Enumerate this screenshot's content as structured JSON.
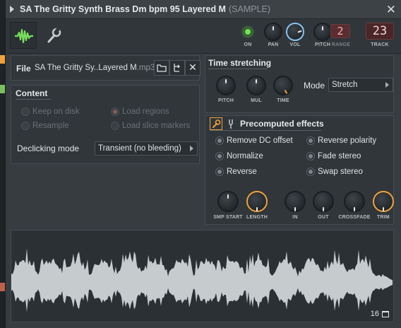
{
  "window": {
    "title": "SA The Gritty Synth Brass Dm bpm 95 Layered M",
    "title_suffix": "(SAMPLE)",
    "close_glyph": "✕"
  },
  "toolbar": {
    "tabs": [
      {
        "name": "waveform-tab",
        "icon": "waveform-icon",
        "active": true
      },
      {
        "name": "settings-tab",
        "icon": "wrench-icon",
        "active": false
      }
    ],
    "on_label": "ON",
    "pan_label": "PAN",
    "vol_label": "VOL",
    "pitch_label": "PITCH",
    "range_label": "RANGE",
    "range_value": "2",
    "track_label": "TRACK",
    "track_value": "23",
    "accent_color": "#f0a23a",
    "on_color": "#79e05c"
  },
  "file": {
    "label": "File",
    "name": "SA The Gritty Sy..Layered M",
    "ext": ".mp3",
    "open_icon": "folder-icon",
    "locate_icon": "tree-icon",
    "clear_icon": "close-icon",
    "clear_glyph": "✕"
  },
  "content": {
    "title": "Content",
    "options": [
      {
        "label": "Keep on disk",
        "state": "off"
      },
      {
        "label": "Load regions",
        "state": "dim-on"
      },
      {
        "label": "Resample",
        "state": "off"
      },
      {
        "label": "Load slice markers",
        "state": "off"
      }
    ],
    "declicking_label": "Declicking mode",
    "declicking_value": "Transient (no bleeding)"
  },
  "time_stretching": {
    "title": "Time stretching",
    "pitch_label": "PITCH",
    "mul_label": "MUL",
    "time_label": "TIME",
    "mode_label": "Mode",
    "mode_value": "Stretch"
  },
  "precomputed": {
    "title": "Precomputed effects",
    "effects": [
      {
        "label": "Remove DC offset",
        "on": true
      },
      {
        "label": "Reverse polarity",
        "on": true
      },
      {
        "label": "Normalize",
        "on": true
      },
      {
        "label": "Fade stereo",
        "on": true
      },
      {
        "label": "Reverse",
        "on": true
      },
      {
        "label": "Swap stereo",
        "on": true
      }
    ],
    "knobs": {
      "smp_start": "SMP START",
      "length": "LENGTH",
      "in": "IN",
      "out": "OUT",
      "crossfade": "CROSSFADE",
      "trim": "TRIM"
    }
  },
  "waveform": {
    "zoom_value": "16",
    "zoom_icon": "zoom-icon",
    "wave_color": "#c6cbce"
  }
}
